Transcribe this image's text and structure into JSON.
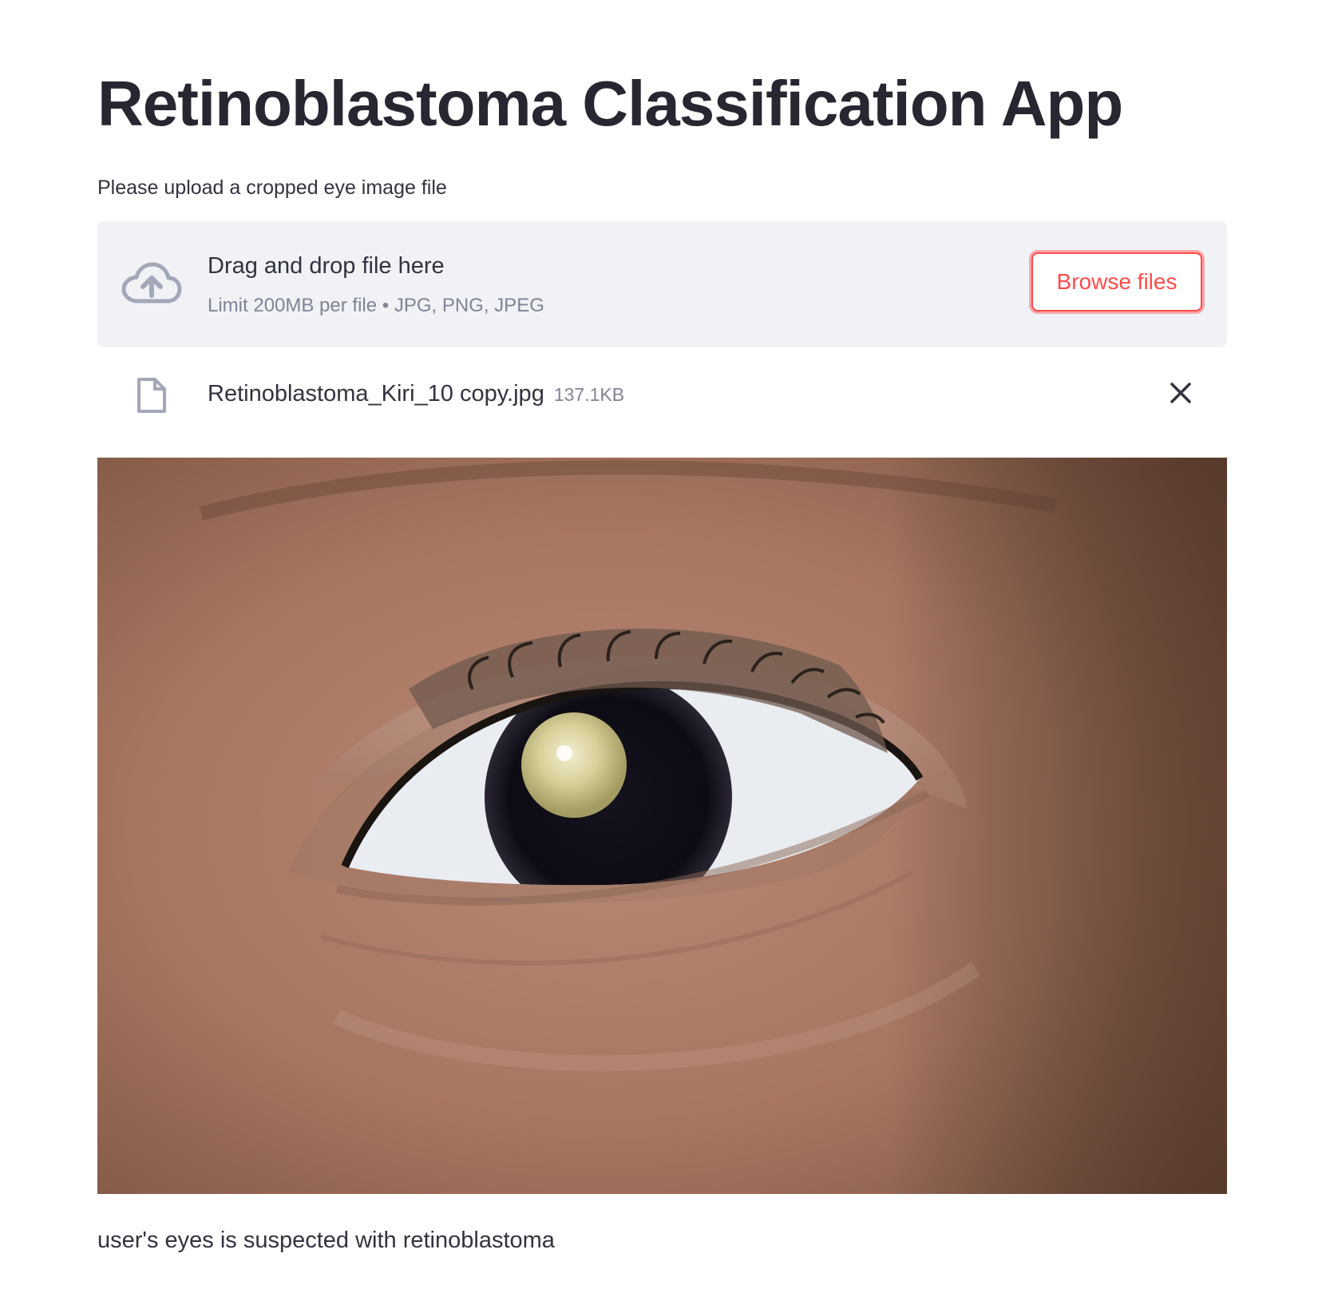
{
  "page": {
    "title": "Retinoblastoma Classification App"
  },
  "uploader": {
    "label": "Please upload a cropped eye image file",
    "drop_text": "Drag and drop file here",
    "limit_text": "Limit 200MB per file • JPG, PNG, JPEG",
    "browse_label": "Browse files",
    "upload_icon": "cloud-upload-icon"
  },
  "uploaded_file": {
    "name": "Retinoblastoma_Kiri_10 copy.jpg",
    "size": "137.1KB",
    "file_icon": "file-icon",
    "remove_icon": "close-icon"
  },
  "result": {
    "text": "user's eyes is suspected with retinoblastoma"
  },
  "colors": {
    "accent": "#ff4b4b",
    "dropzone_bg": "#f0f2f6",
    "text": "#31333f",
    "muted": "#808495"
  }
}
